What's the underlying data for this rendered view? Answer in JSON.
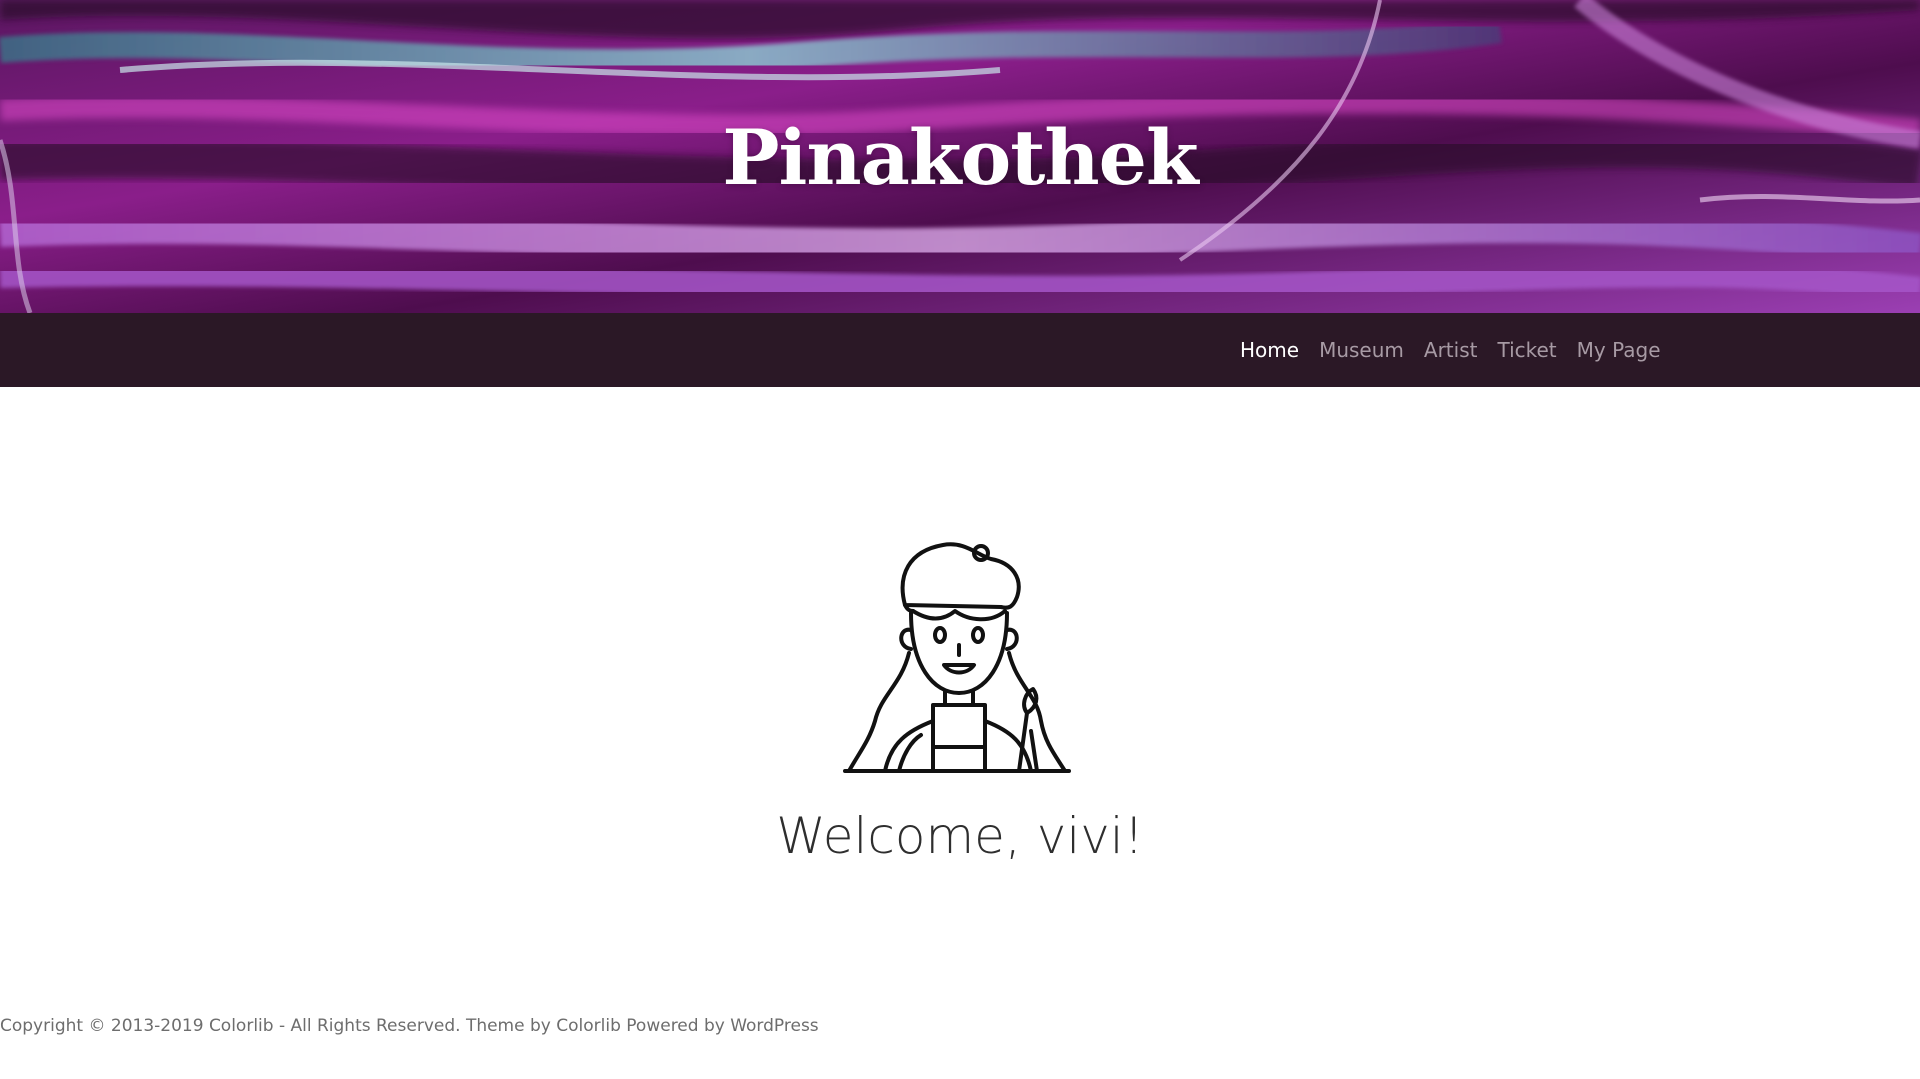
{
  "header": {
    "site_title": "Pinakothek"
  },
  "nav": {
    "items": [
      {
        "label": "Home",
        "active": true
      },
      {
        "label": "Museum",
        "active": false
      },
      {
        "label": "Artist",
        "active": false
      },
      {
        "label": "Ticket",
        "active": false
      },
      {
        "label": "My Page",
        "active": false
      }
    ]
  },
  "main": {
    "avatar_icon": "artist-avatar-icon",
    "welcome": "Welcome, vivi!"
  },
  "footer": {
    "copyright": "Copyright © 2013-2019 Colorlib - All Rights Reserved. Theme by",
    "theme_link": "Colorlib",
    "powered_text": "Powered by",
    "powered_link": "WordPress"
  },
  "colors": {
    "nav_background": "#2b1826",
    "nav_text": "#a79aa4",
    "nav_active": "#ffffff",
    "hero_primary": "#8a1e8a",
    "hero_accent": "#c85ad0",
    "hero_teal": "#7fb5c4"
  }
}
